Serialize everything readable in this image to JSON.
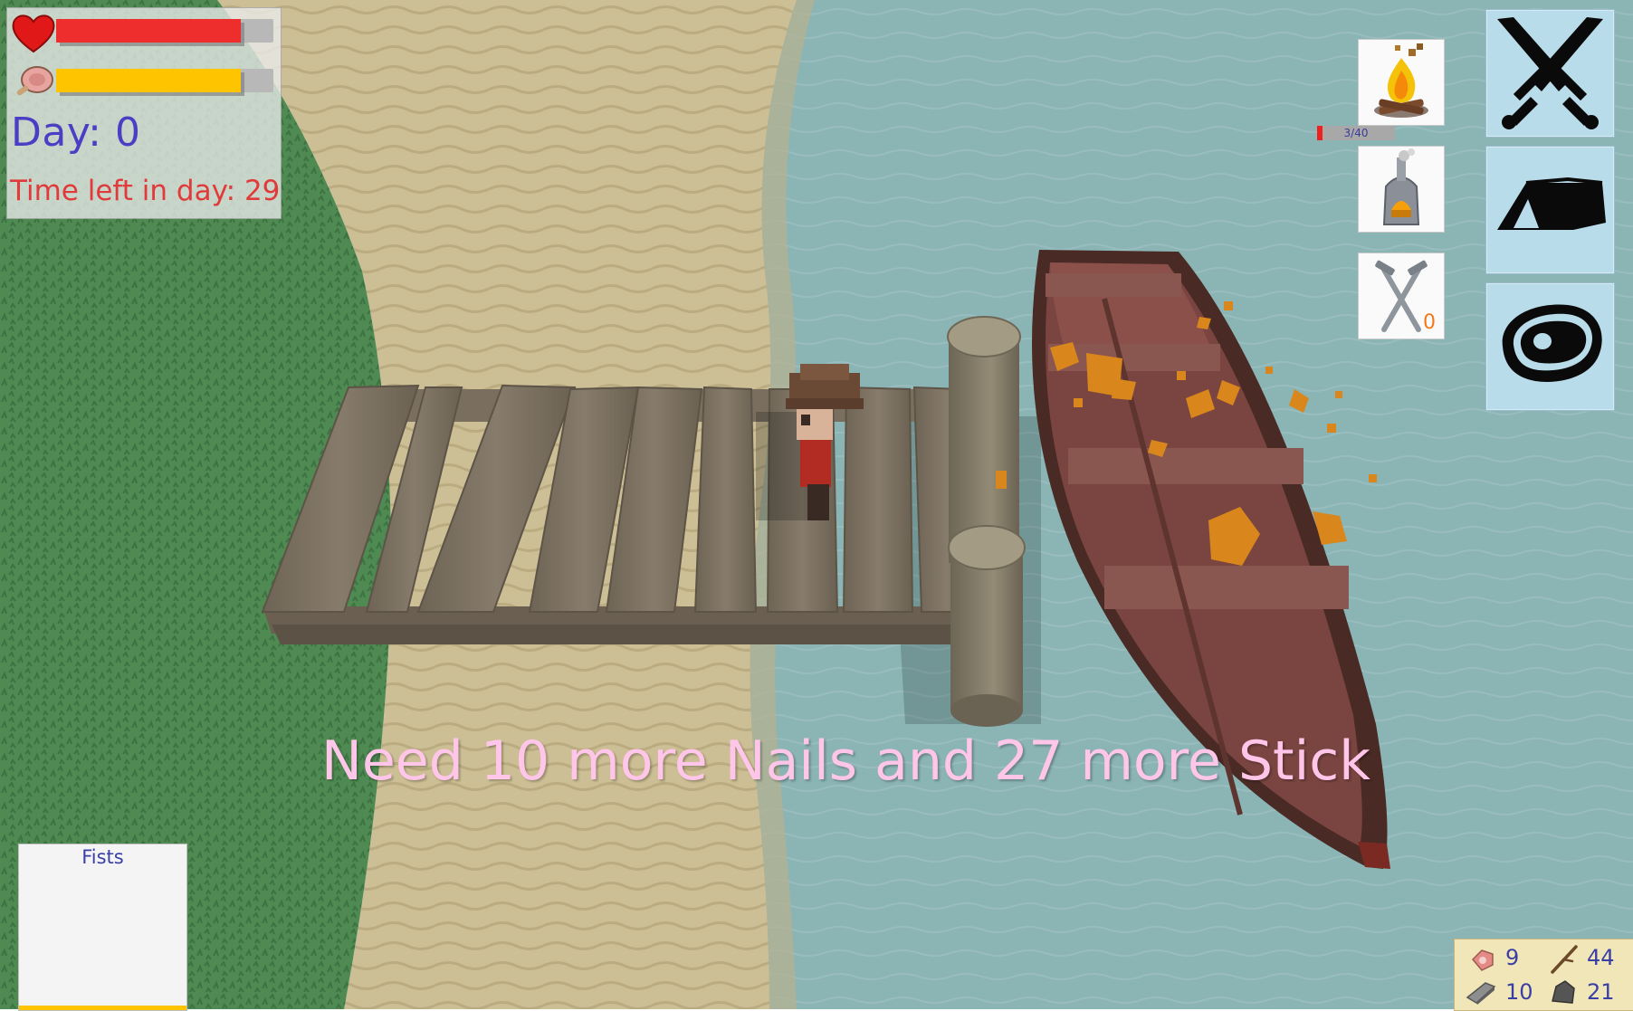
{
  "hud": {
    "health": 0.85,
    "hunger": 0.85,
    "day_text": "Day: 0",
    "time_left_text": "Time left in day: 29"
  },
  "crafting": {
    "items": [
      {
        "icon": "campfire-icon"
      },
      {
        "icon": "furnace-icon"
      },
      {
        "icon": "nails-icon",
        "count": "0"
      }
    ],
    "progress_text": "3/40",
    "progress_fraction": 0.075
  },
  "modes": [
    {
      "icon": "crossed-swords-icon"
    },
    {
      "icon": "tent-icon"
    },
    {
      "icon": "steak-icon"
    }
  ],
  "message": "Need 10 more Nails and 27 more Stick",
  "weapon": {
    "label": "Fists"
  },
  "resources": {
    "meat": "9",
    "stick": "44",
    "iron": "10",
    "stone": "21"
  },
  "colors": {
    "health": "#ee2d2d",
    "hunger": "#ffc400",
    "day_text": "#4a3fc4",
    "time_text": "#e03a3a",
    "message": "#ffc6ea",
    "mode_button_bg": "#b9dcea"
  }
}
